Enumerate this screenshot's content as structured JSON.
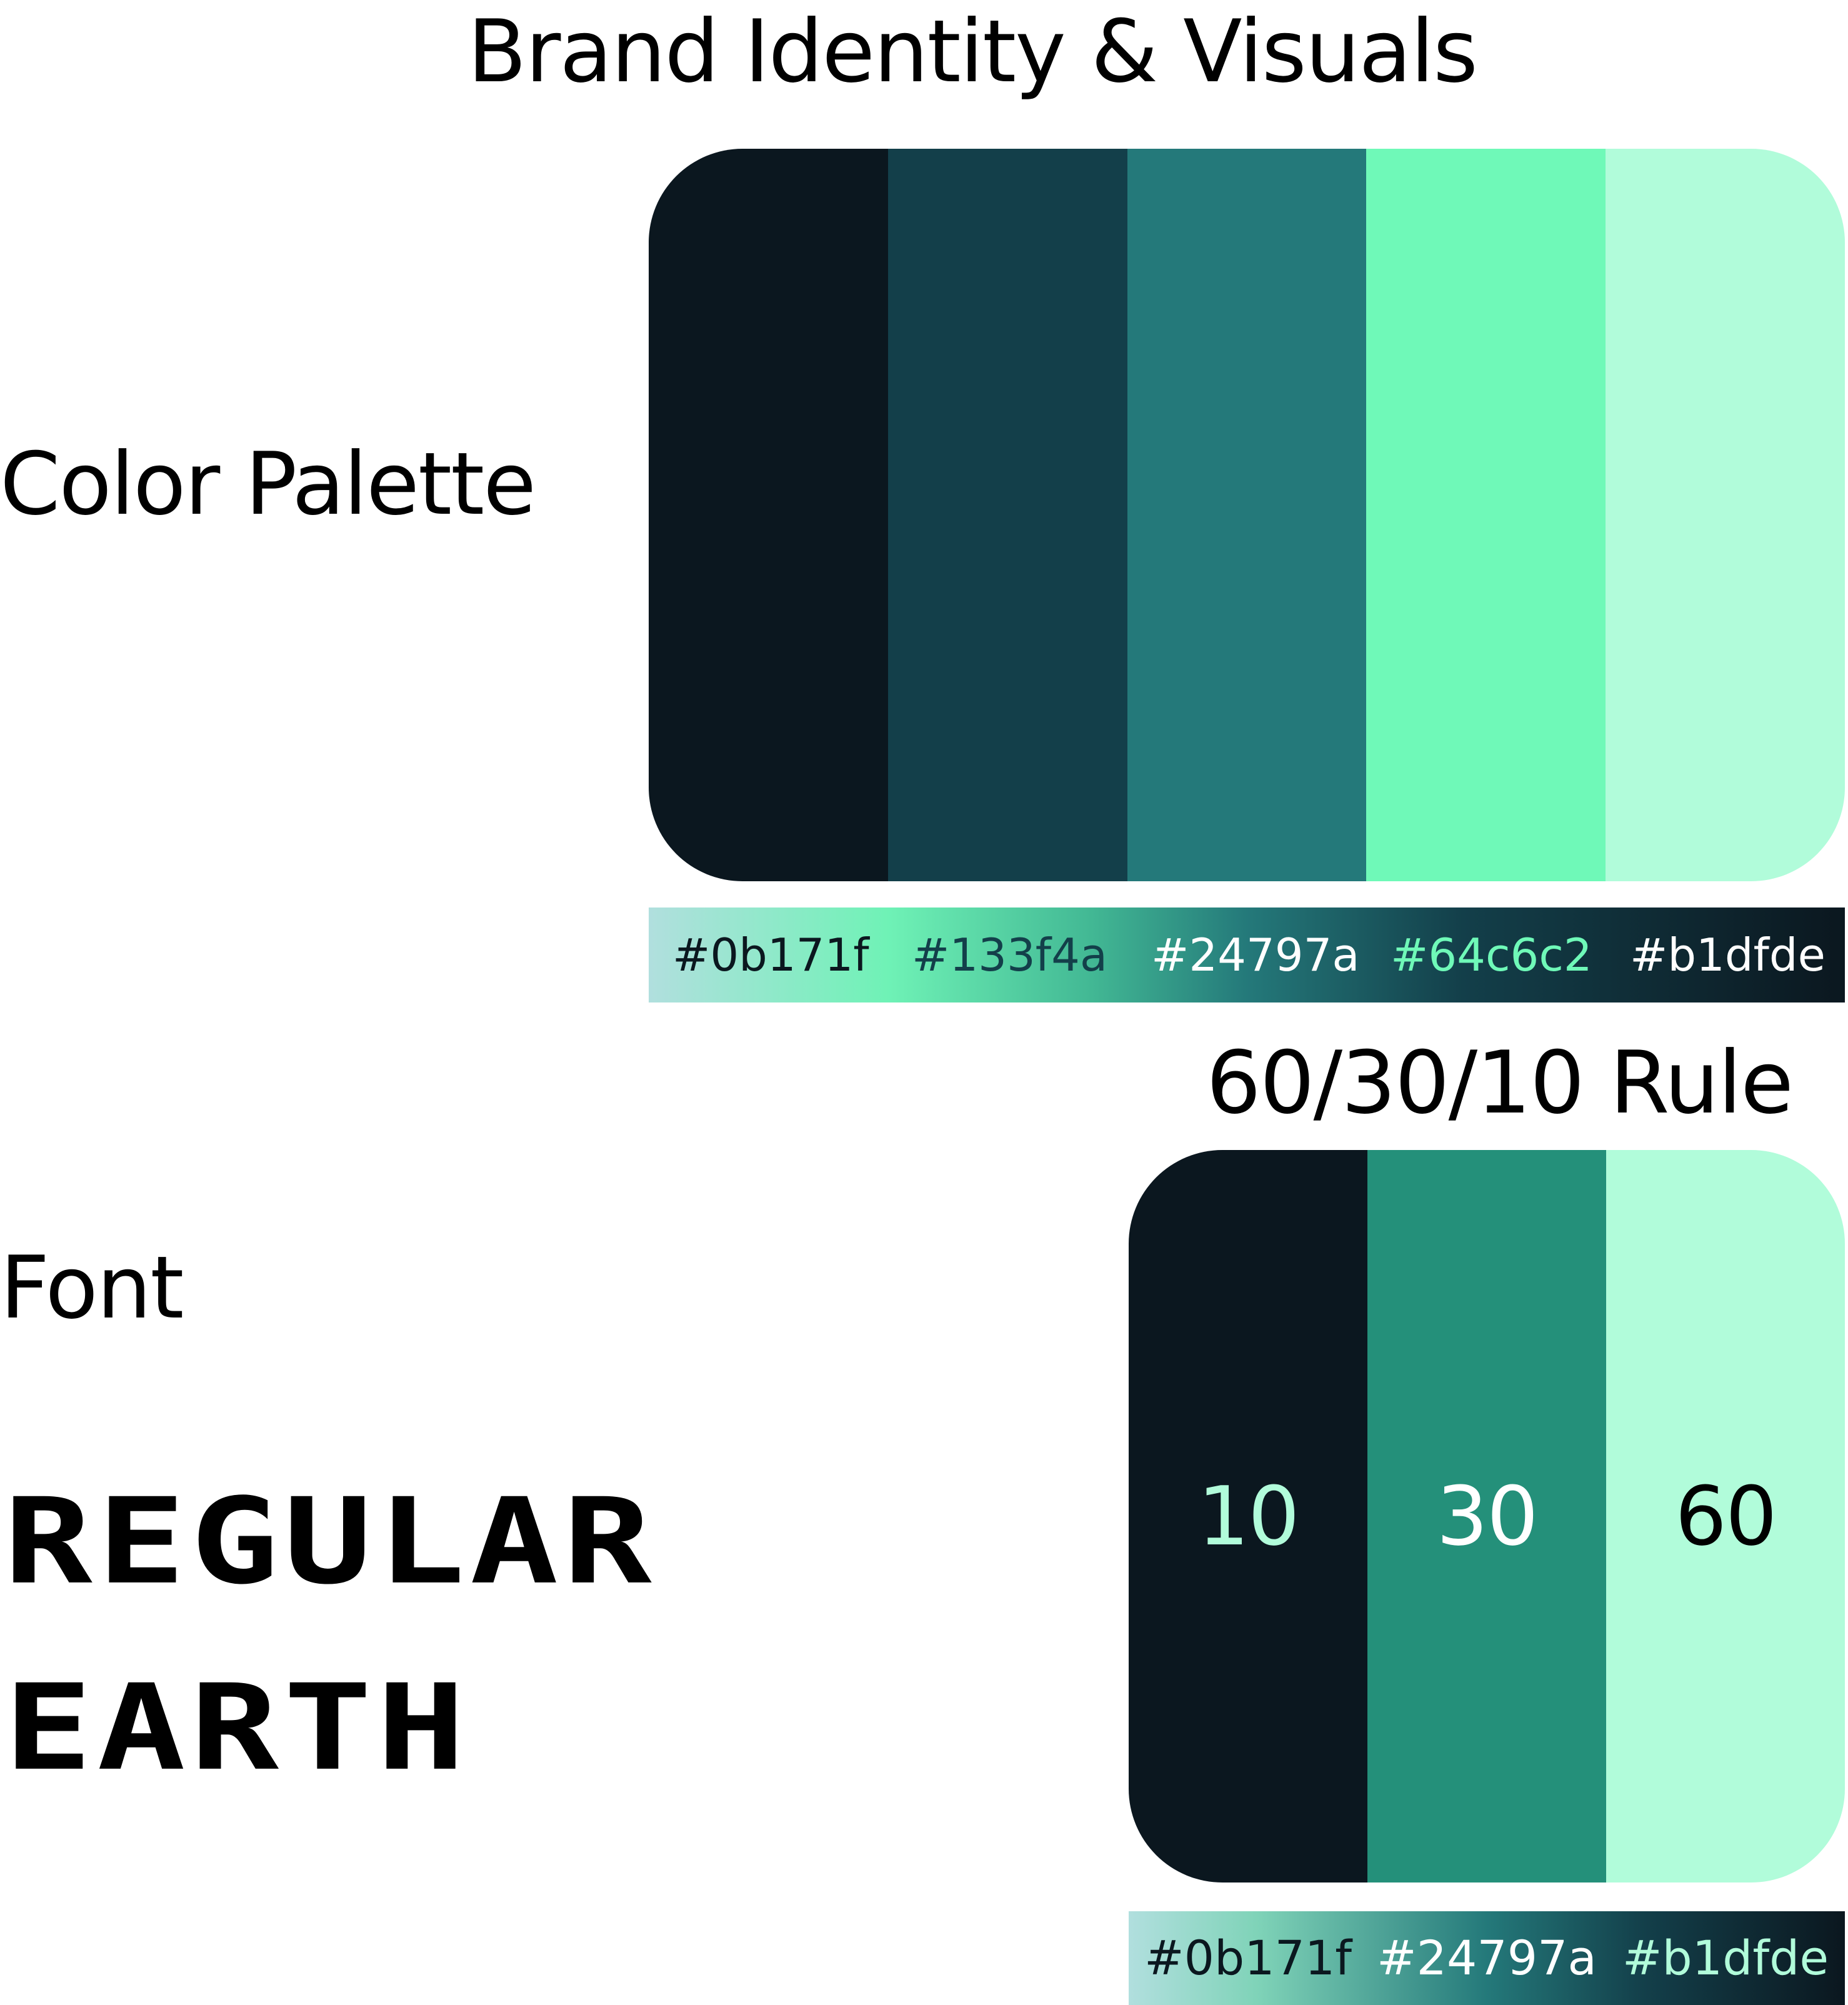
{
  "title": "Brand Identity & Visuals",
  "sections": {
    "palette_label": "Color Palette",
    "rule_title": "60/30/10 Rule",
    "font_label": "Font"
  },
  "palette": {
    "swatches": [
      {
        "color": "#0b171f"
      },
      {
        "color": "#133f4a"
      },
      {
        "color": "#24797a"
      },
      {
        "color": "#6ff9b8"
      },
      {
        "color": "#b1fcda"
      }
    ],
    "hex_labels": [
      {
        "text": "#0b171f",
        "color": "#0b171f"
      },
      {
        "text": "#133f4a",
        "color": "#133f4a"
      },
      {
        "text": "#24797a",
        "color": "#ffffff"
      },
      {
        "text": "#64c6c2",
        "color": "#6ff9b8"
      },
      {
        "text": "#b1dfde",
        "color": "#ffffff"
      }
    ]
  },
  "rule": {
    "parts": [
      {
        "value": "10",
        "color": "#0b171f",
        "text_color": "#b1fcda"
      },
      {
        "value": "30",
        "color": "#24907a",
        "text_color": "#ffffff"
      },
      {
        "value": "60",
        "color": "#b1fcda",
        "text_color": "#000000"
      }
    ],
    "hex_labels": [
      {
        "text": "#0b171f",
        "color": "#0b171f"
      },
      {
        "text": "#24797a",
        "color": "#ffffff"
      },
      {
        "text": "#b1dfde",
        "color": "#b1fcda"
      }
    ]
  },
  "font_specimen": {
    "line1": "REGULAR",
    "line2": "EARTH"
  }
}
